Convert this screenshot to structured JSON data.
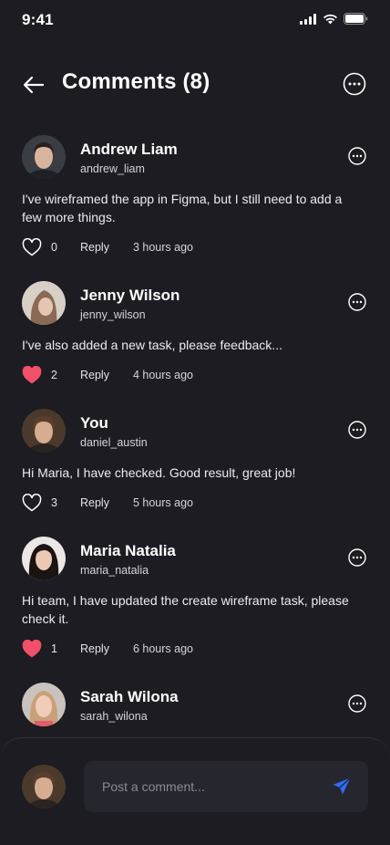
{
  "status": {
    "time": "9:41"
  },
  "header": {
    "title": "Comments (8)"
  },
  "comments": [
    {
      "name": "Andrew Liam",
      "handle": "andrew_liam",
      "text": "I've wireframed the app in Figma, but I still need to add a few more things.",
      "likes": "0",
      "liked": false,
      "reply": "Reply",
      "time": "3 hours ago"
    },
    {
      "name": "Jenny Wilson",
      "handle": "jenny_wilson",
      "text": "I've also added a new task, please feedback...",
      "likes": "2",
      "liked": true,
      "reply": "Reply",
      "time": "4 hours ago"
    },
    {
      "name": "You",
      "handle": "daniel_austin",
      "text": "Hi Maria, I have checked. Good result, great job!",
      "likes": "3",
      "liked": false,
      "reply": "Reply",
      "time": "5 hours ago"
    },
    {
      "name": "Maria Natalia",
      "handle": "maria_natalia",
      "text": "Hi team, I have updated the create wireframe task, please check it.",
      "likes": "1",
      "liked": true,
      "reply": "Reply",
      "time": "6 hours ago"
    },
    {
      "name": "Sarah Wilona",
      "handle": "sarah_wilona"
    }
  ],
  "composer": {
    "placeholder": "Post a comment..."
  },
  "colors": {
    "background": "#1c1c22",
    "input": "#26262e",
    "like": "#f2506a",
    "send": "#2f6bff"
  },
  "icons": {
    "back": "arrow-left-icon",
    "more": "more-horizontal-icon",
    "heart": "heart-icon",
    "send": "send-icon"
  }
}
